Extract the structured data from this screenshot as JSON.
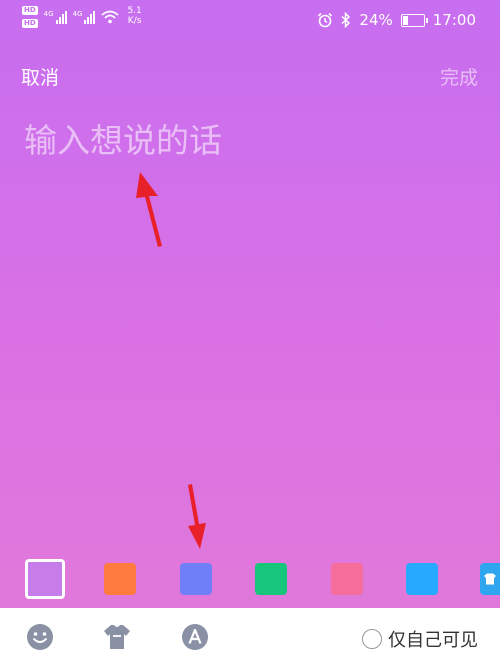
{
  "status_bar": {
    "hd1": "HD",
    "hd2": "HD",
    "net1": "4G",
    "net2": "4G",
    "speed_value": "5.1",
    "speed_unit": "K/s",
    "battery": "24%",
    "battery_level": 0.24,
    "time": "17:00"
  },
  "header": {
    "cancel_label": "取消",
    "done_label": "完成"
  },
  "editor": {
    "placeholder": "输入想说的话"
  },
  "colors": {
    "swatches": [
      "#c67de9",
      "#ff7a3d",
      "#6f7ff8",
      "#17c67a",
      "#f56d9a",
      "#27aaff",
      "#2fa6ef"
    ],
    "arrow": "#e8202a"
  },
  "toolbar": {
    "private_label": "仅自己可见"
  }
}
